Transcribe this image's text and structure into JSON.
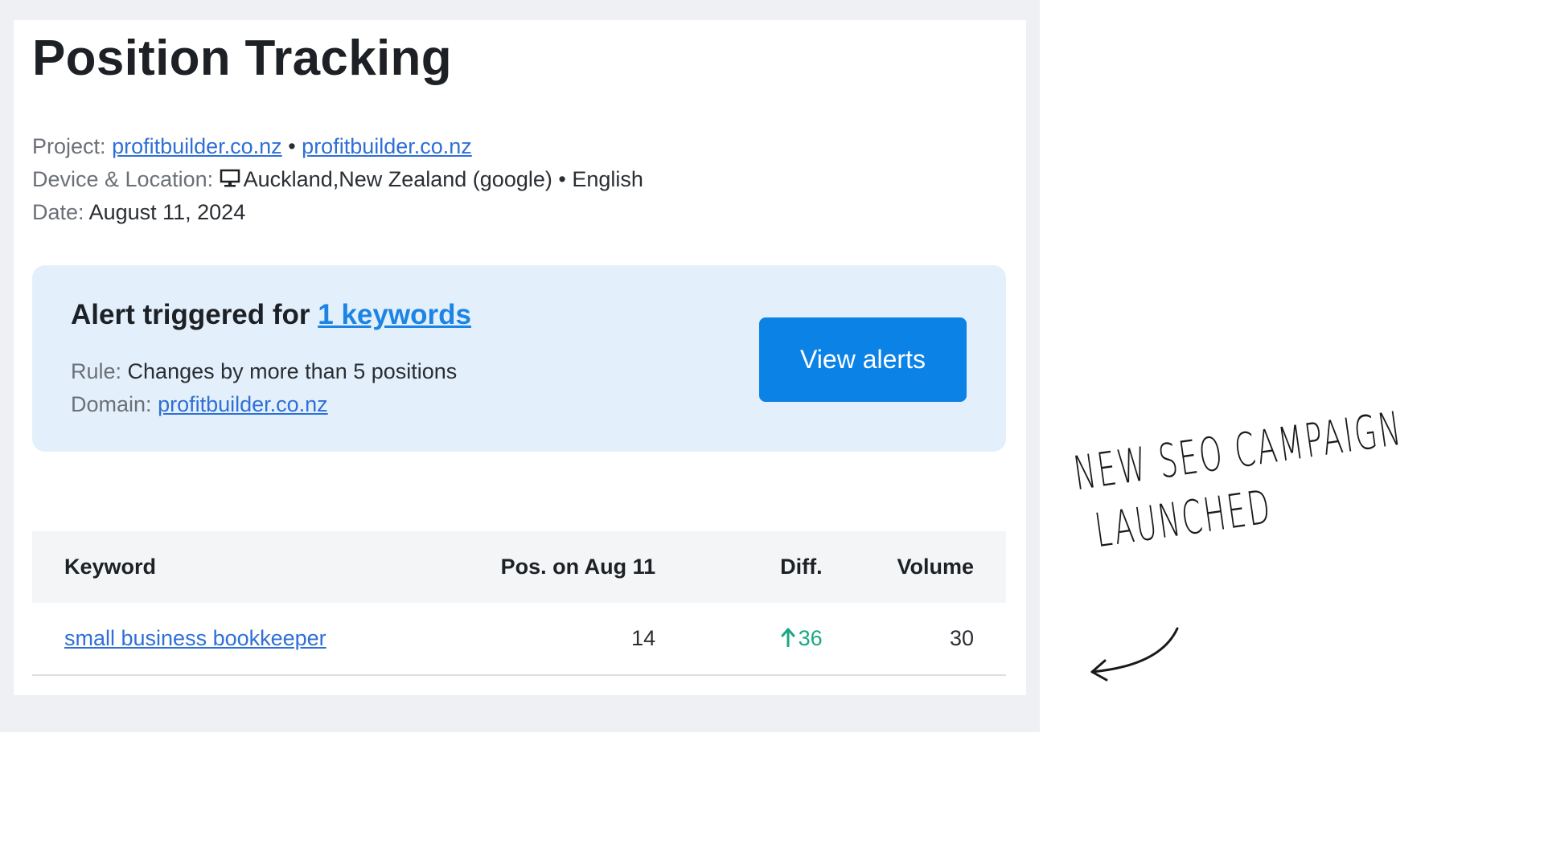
{
  "page": {
    "title": "Position Tracking"
  },
  "meta": {
    "project_label": "Project:",
    "project_link_1": "profitbuilder.co.nz",
    "separator": "•",
    "project_link_2": "profitbuilder.co.nz",
    "device_label": "Device & Location:",
    "device_icon": "desktop-monitor-icon",
    "location": "Auckland,New Zealand (google)",
    "language_separator": "•",
    "language": "English",
    "date_label": "Date:",
    "date": "August 11, 2024"
  },
  "alert": {
    "title_prefix": "Alert triggered for",
    "keywords_link": "1 keywords",
    "rule_label": "Rule:",
    "rule_value": "Changes by more than 5 positions",
    "domain_label": "Domain:",
    "domain_link": "profitbuilder.co.nz",
    "button_label": "View alerts"
  },
  "table": {
    "headers": {
      "keyword": "Keyword",
      "position": "Pos. on Aug 11",
      "diff": "Diff.",
      "volume": "Volume"
    },
    "rows": [
      {
        "keyword": "small business bookkeeper",
        "position": "14",
        "diff": "36",
        "diff_direction": "up",
        "volume": "30"
      }
    ]
  },
  "annotation": {
    "line1": "NEW SEO CAMPAIGN",
    "line2": "LAUNCHED"
  },
  "colors": {
    "accent": "#0b82e6",
    "link": "#2f6fd6",
    "positive": "#18a883",
    "alert_bg": "#e3f0fb"
  }
}
